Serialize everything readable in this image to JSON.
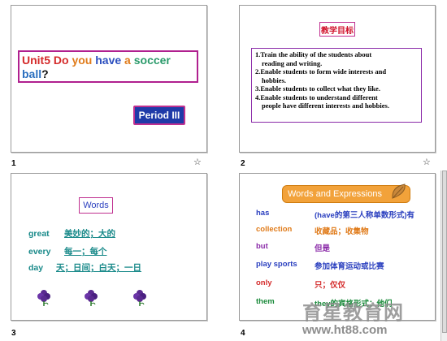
{
  "slides": [
    {
      "number": "1",
      "title_parts": [
        "Unit5 ",
        "Do ",
        "you ",
        "have ",
        "a ",
        "soccer ",
        "ball",
        "?"
      ],
      "title_colors": [
        "#d42a2a",
        "#d42a2a",
        "#e07b1a",
        "#2c4fbf",
        "#e07b1a",
        "#2a9a6a",
        "#2a6fbf",
        "#111111"
      ],
      "period_label": "Period III"
    },
    {
      "number": "2",
      "heading": "教学目标",
      "objectives": [
        "1.Train the ability of the students about",
        "   reading and writing.",
        "2.Enable students to form wide interests and",
        "   hobbies.",
        "3.Enable students to collect what they like.",
        "4.Enable students to understand different",
        "   people have different interests and hobbies."
      ]
    },
    {
      "number": "3",
      "heading": "Words",
      "words": [
        {
          "en": "great",
          "zh": "美妙的；大的"
        },
        {
          "en": "every",
          "zh": "每一；每个"
        },
        {
          "en": "day",
          "zh": "天；日间；白天；一日"
        }
      ]
    },
    {
      "number": "4",
      "heading": "Words and Expressions",
      "items": [
        {
          "en": "has",
          "zh": "(have的第三人称单数形式)有",
          "en_color": "#2a3fbf",
          "zh_color": "#2a3fbf"
        },
        {
          "en": "collection",
          "zh": "收藏品；收集物",
          "en_color": "#e07b1a",
          "zh_color": "#e07b1a"
        },
        {
          "en": "but",
          "zh": "但是",
          "en_color": "#8a2aa8",
          "zh_color": "#8a2aa8"
        },
        {
          "en": "play sports",
          "zh": "参加体育运动或比赛",
          "en_color": "#2a3fbf",
          "zh_color": "#2a3fbf"
        },
        {
          "en": "only",
          "zh": "只；仅仅",
          "en_color": "#d42a2a",
          "zh_color": "#d42a2a"
        },
        {
          "en": "them",
          "zh": "they的宾格形式；他们",
          "en_color": "#1a8a3a",
          "zh_color": "#1a8a3a"
        }
      ]
    }
  ],
  "watermark": {
    "text_cn": "育星教育网",
    "url": "www.ht88.com"
  },
  "icons": {
    "slide_animation": "transition-icon",
    "bullet_decoration": "grape-flower-icon"
  }
}
